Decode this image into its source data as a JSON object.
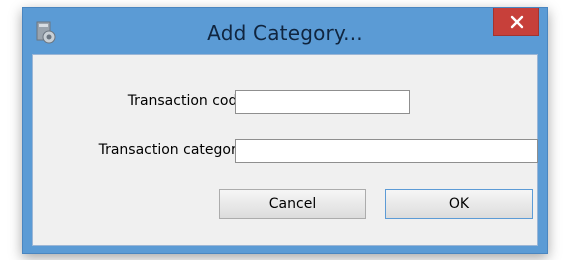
{
  "window": {
    "title": "Add Category...",
    "app_icon": "application-icon",
    "close_icon": "close-icon",
    "titlebar_color": "#5b9bd5",
    "close_color": "#c7403a"
  },
  "form": {
    "code_label": "Transaction code",
    "code_value": "",
    "category_label": "Transaction category",
    "category_value": ""
  },
  "buttons": {
    "cancel_label": "Cancel",
    "ok_label": "OK"
  }
}
